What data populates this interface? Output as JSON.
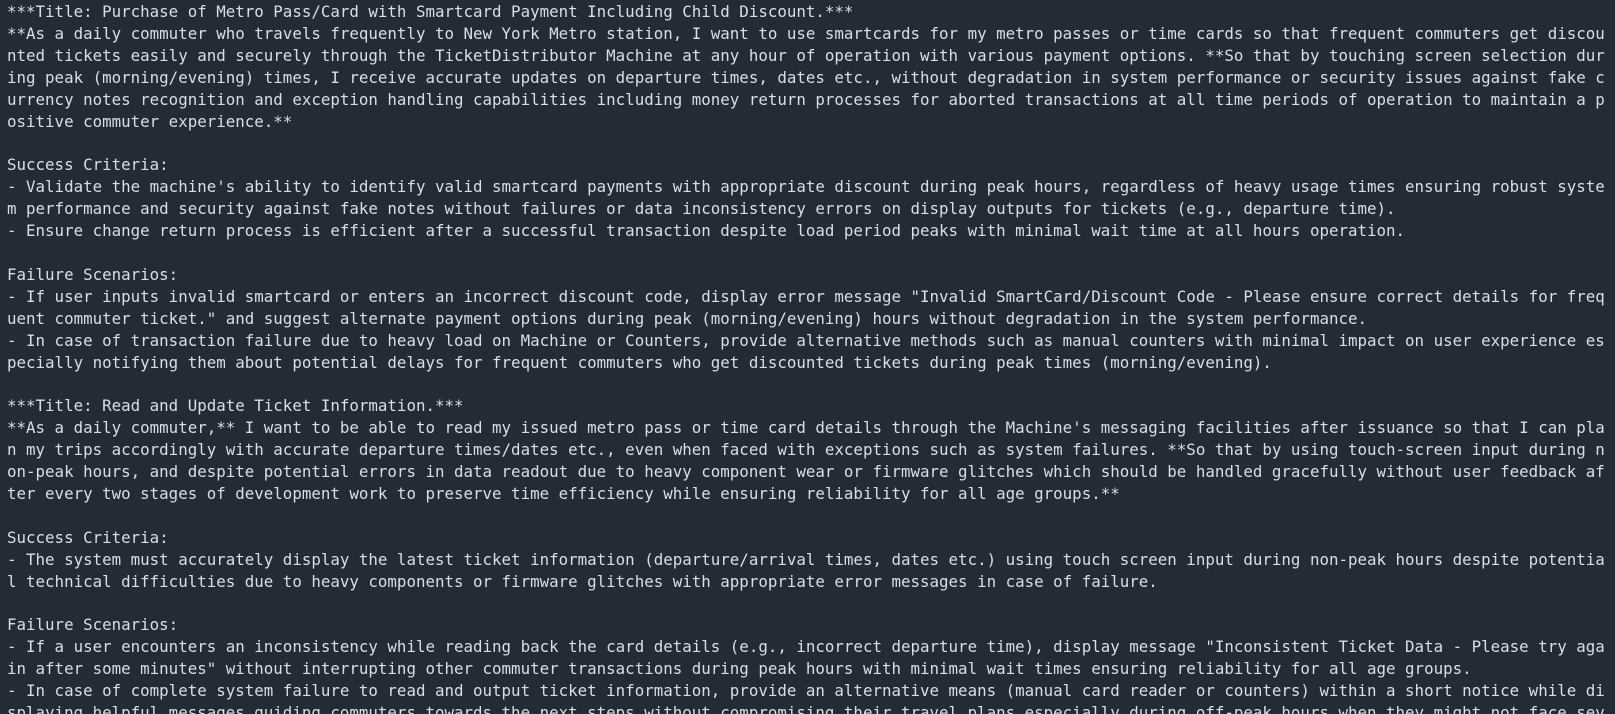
{
  "output": {
    "text": "***Title: Purchase of Metro Pass/Card with Smartcard Payment Including Child Discount.***\n**As a daily commuter who travels frequently to New York Metro station, I want to use smartcards for my metro passes or time cards so that frequent commuters get discounted tickets easily and securely through the TicketDistributor Machine at any hour of operation with various payment options. **So that by touching screen selection during peak (morning/evening) times, I receive accurate updates on departure times, dates etc., without degradation in system performance or security issues against fake currency notes recognition and exception handling capabilities including money return processes for aborted transactions at all time periods of operation to maintain a positive commuter experience.**\n\nSuccess Criteria:\n- Validate the machine's ability to identify valid smartcard payments with appropriate discount during peak hours, regardless of heavy usage times ensuring robust system performance and security against fake notes without failures or data inconsistency errors on display outputs for tickets (e.g., departure time).\n- Ensure change return process is efficient after a successful transaction despite load period peaks with minimal wait time at all hours operation.\n\nFailure Scenarios:\n- If user inputs invalid smartcard or enters an incorrect discount code, display error message \"Invalid SmartCard/Discount Code - Please ensure correct details for frequent commuter ticket.\" and suggest alternate payment options during peak (morning/evening) hours without degradation in the system performance.\n- In case of transaction failure due to heavy load on Machine or Counters, provide alternative methods such as manual counters with minimal impact on user experience especially notifying them about potential delays for frequent commuters who get discounted tickets during peak times (morning/evening).\n\n***Title: Read and Update Ticket Information.***\n**As a daily commuter,** I want to be able to read my issued metro pass or time card details through the Machine's messaging facilities after issuance so that I can plan my trips accordingly with accurate departure times/dates etc., even when faced with exceptions such as system failures. **So that by using touch-screen input during non-peak hours, and despite potential errors in data readout due to heavy component wear or firmware glitches which should be handled gracefully without user feedback after every two stages of development work to preserve time efficiency while ensuring reliability for all age groups.**\n\nSuccess Criteria:\n- The system must accurately display the latest ticket information (departure/arrival times, dates etc.) using touch screen input during non-peak hours despite potential technical difficulties due to heavy components or firmware glitches with appropriate error messages in case of failure.\n\nFailure Scenarios:\n- If a user encounters an inconsistency while reading back the card details (e.g., incorrect departure time), display message \"Inconsistent Ticket Data - Please try again after some minutes\" without interrupting other commuter transactions during peak hours with minimal wait times ensuring reliability for all age groups.\n- In case of complete system failure to read and output ticket information, provide an alternative means (manual card reader or counters) within a short notice while displaying helpful messages guiding commuters towards the next steps without compromising their travel plans especially during off-peak hours when they might not face severe delays."
  }
}
